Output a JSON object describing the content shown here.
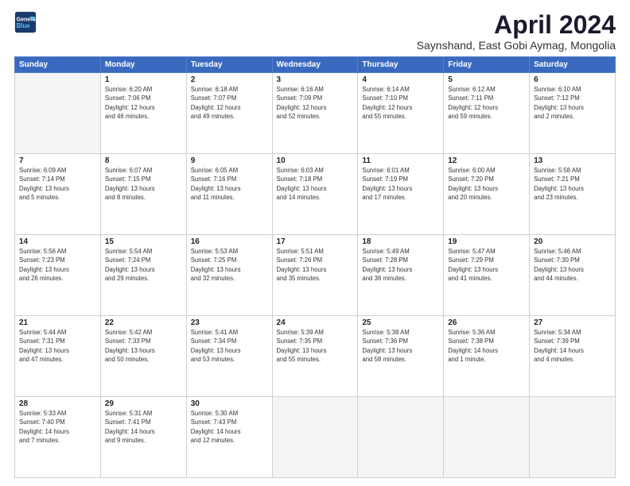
{
  "logo": {
    "line1": "General",
    "line2": "Blue"
  },
  "title": "April 2024",
  "subtitle": "Saynshand, East Gobi Aymag, Mongolia",
  "days_of_week": [
    "Sunday",
    "Monday",
    "Tuesday",
    "Wednesday",
    "Thursday",
    "Friday",
    "Saturday"
  ],
  "weeks": [
    [
      {
        "num": "",
        "info": ""
      },
      {
        "num": "1",
        "info": "Sunrise: 6:20 AM\nSunset: 7:06 PM\nDaylight: 12 hours\nand 46 minutes."
      },
      {
        "num": "2",
        "info": "Sunrise: 6:18 AM\nSunset: 7:07 PM\nDaylight: 12 hours\nand 49 minutes."
      },
      {
        "num": "3",
        "info": "Sunrise: 6:16 AM\nSunset: 7:09 PM\nDaylight: 12 hours\nand 52 minutes."
      },
      {
        "num": "4",
        "info": "Sunrise: 6:14 AM\nSunset: 7:10 PM\nDaylight: 12 hours\nand 55 minutes."
      },
      {
        "num": "5",
        "info": "Sunrise: 6:12 AM\nSunset: 7:11 PM\nDaylight: 12 hours\nand 59 minutes."
      },
      {
        "num": "6",
        "info": "Sunrise: 6:10 AM\nSunset: 7:12 PM\nDaylight: 13 hours\nand 2 minutes."
      }
    ],
    [
      {
        "num": "7",
        "info": "Sunrise: 6:09 AM\nSunset: 7:14 PM\nDaylight: 13 hours\nand 5 minutes."
      },
      {
        "num": "8",
        "info": "Sunrise: 6:07 AM\nSunset: 7:15 PM\nDaylight: 13 hours\nand 8 minutes."
      },
      {
        "num": "9",
        "info": "Sunrise: 6:05 AM\nSunset: 7:16 PM\nDaylight: 13 hours\nand 11 minutes."
      },
      {
        "num": "10",
        "info": "Sunrise: 6:03 AM\nSunset: 7:18 PM\nDaylight: 13 hours\nand 14 minutes."
      },
      {
        "num": "11",
        "info": "Sunrise: 6:01 AM\nSunset: 7:19 PM\nDaylight: 13 hours\nand 17 minutes."
      },
      {
        "num": "12",
        "info": "Sunrise: 6:00 AM\nSunset: 7:20 PM\nDaylight: 13 hours\nand 20 minutes."
      },
      {
        "num": "13",
        "info": "Sunrise: 5:58 AM\nSunset: 7:21 PM\nDaylight: 13 hours\nand 23 minutes."
      }
    ],
    [
      {
        "num": "14",
        "info": "Sunrise: 5:56 AM\nSunset: 7:23 PM\nDaylight: 13 hours\nand 26 minutes."
      },
      {
        "num": "15",
        "info": "Sunrise: 5:54 AM\nSunset: 7:24 PM\nDaylight: 13 hours\nand 29 minutes."
      },
      {
        "num": "16",
        "info": "Sunrise: 5:53 AM\nSunset: 7:25 PM\nDaylight: 13 hours\nand 32 minutes."
      },
      {
        "num": "17",
        "info": "Sunrise: 5:51 AM\nSunset: 7:26 PM\nDaylight: 13 hours\nand 35 minutes."
      },
      {
        "num": "18",
        "info": "Sunrise: 5:49 AM\nSunset: 7:28 PM\nDaylight: 13 hours\nand 38 minutes."
      },
      {
        "num": "19",
        "info": "Sunrise: 5:47 AM\nSunset: 7:29 PM\nDaylight: 13 hours\nand 41 minutes."
      },
      {
        "num": "20",
        "info": "Sunrise: 5:46 AM\nSunset: 7:30 PM\nDaylight: 13 hours\nand 44 minutes."
      }
    ],
    [
      {
        "num": "21",
        "info": "Sunrise: 5:44 AM\nSunset: 7:31 PM\nDaylight: 13 hours\nand 47 minutes."
      },
      {
        "num": "22",
        "info": "Sunrise: 5:42 AM\nSunset: 7:33 PM\nDaylight: 13 hours\nand 50 minutes."
      },
      {
        "num": "23",
        "info": "Sunrise: 5:41 AM\nSunset: 7:34 PM\nDaylight: 13 hours\nand 53 minutes."
      },
      {
        "num": "24",
        "info": "Sunrise: 5:39 AM\nSunset: 7:35 PM\nDaylight: 13 hours\nand 55 minutes."
      },
      {
        "num": "25",
        "info": "Sunrise: 5:38 AM\nSunset: 7:36 PM\nDaylight: 13 hours\nand 58 minutes."
      },
      {
        "num": "26",
        "info": "Sunrise: 5:36 AM\nSunset: 7:38 PM\nDaylight: 14 hours\nand 1 minute."
      },
      {
        "num": "27",
        "info": "Sunrise: 5:34 AM\nSunset: 7:39 PM\nDaylight: 14 hours\nand 4 minutes."
      }
    ],
    [
      {
        "num": "28",
        "info": "Sunrise: 5:33 AM\nSunset: 7:40 PM\nDaylight: 14 hours\nand 7 minutes."
      },
      {
        "num": "29",
        "info": "Sunrise: 5:31 AM\nSunset: 7:41 PM\nDaylight: 14 hours\nand 9 minutes."
      },
      {
        "num": "30",
        "info": "Sunrise: 5:30 AM\nSunset: 7:43 PM\nDaylight: 14 hours\nand 12 minutes."
      },
      {
        "num": "",
        "info": ""
      },
      {
        "num": "",
        "info": ""
      },
      {
        "num": "",
        "info": ""
      },
      {
        "num": "",
        "info": ""
      }
    ]
  ]
}
